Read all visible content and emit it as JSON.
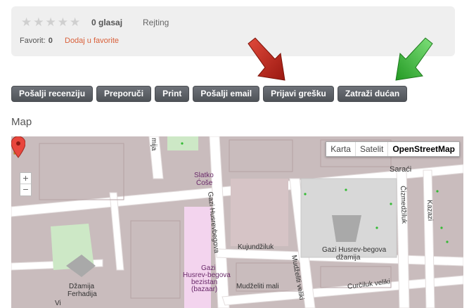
{
  "rating": {
    "stars_total": 5,
    "stars_filled": 0,
    "votes": "0 glasaj",
    "label": "Rejting"
  },
  "favorites": {
    "label": "Favorit:",
    "count": "0",
    "link": "Dodaj u favorite"
  },
  "buttons": {
    "review": "Pošalji recenziju",
    "recommend": "Preporuči",
    "print": "Print",
    "email": "Pošalji email",
    "report": "Prijavi grešku",
    "claim": "Zatraži dućan"
  },
  "colors": {
    "red_arrow": "#c8261a",
    "green_arrow": "#3fb83f",
    "favorite_link": "#d9603a"
  },
  "map_section": {
    "title": "Map",
    "types": [
      "Karta",
      "Satelit",
      "OpenStreetMap"
    ],
    "active_type": "OpenStreetMap",
    "zoom_in": "+",
    "zoom_out": "−",
    "labels": {
      "sarajevo_street": "Saraći",
      "slatko": "Slatko",
      "cose": "Ćoše",
      "gazi_street": "Gazi Husrevbegova",
      "kujundziluk": "Kujundžiluk",
      "mudzeliti_veliki": "Mudželiti veliki",
      "mudzeliti_mali": "Mudželiti mali",
      "curcilu": "Curčiluk veliki",
      "czmedziluk": "Čizmedžiluk",
      "kazazi": "Kazazi",
      "bezistan_1": "Gazi",
      "bezistan_2": "Husrev-begova",
      "bezistan_3": "bezistan",
      "bezistan_4": "(bazaar)",
      "dzamija_1": "Gazi Husrev-begova",
      "dzamija_2": "džamija",
      "ferhadija_1": "Džamija",
      "ferhadija_2": "Ferhadija",
      "mija": "mija",
      "vi": "Vi"
    }
  }
}
